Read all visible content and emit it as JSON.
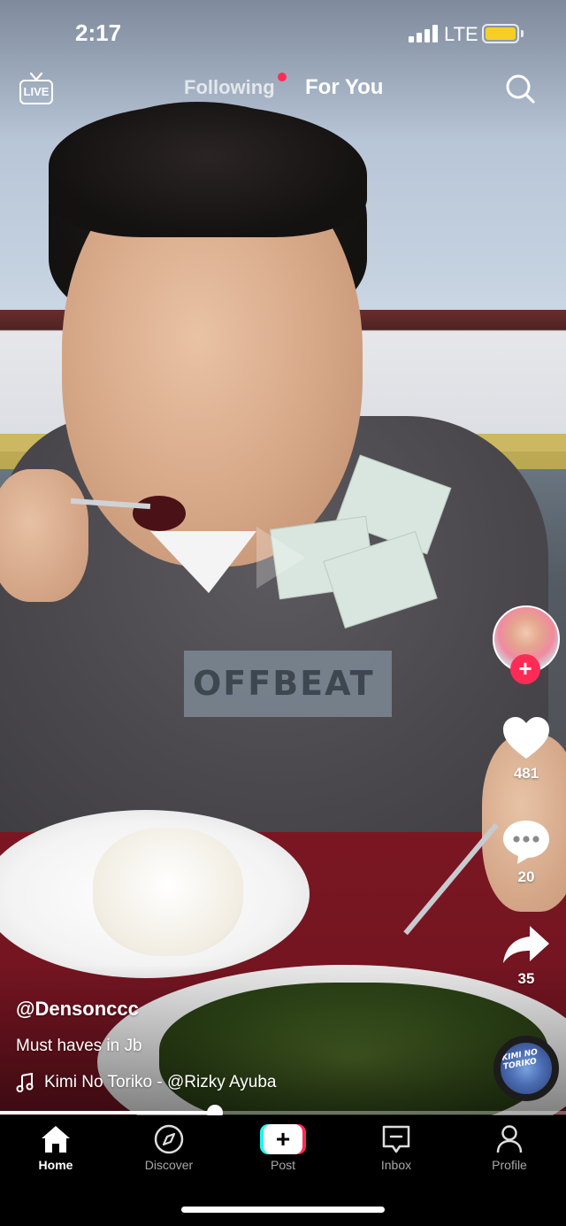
{
  "status_bar": {
    "time": "2:17",
    "network": "LTE",
    "battery_color": "#f5cf24"
  },
  "top_nav": {
    "live_label": "LIVE",
    "tabs": [
      {
        "label": "Following",
        "active": false,
        "has_notification_dot": true
      },
      {
        "label": "For You",
        "active": true
      }
    ],
    "search_icon": "search-icon"
  },
  "video": {
    "username": "@Densonccc",
    "caption": "Must haves in Jb",
    "music": "Kimi No Toriko - @Rizky Ayuba",
    "shirt_print": "OFFBEAT",
    "disc_text": "KIMI NO TORIKO",
    "progress": 0.38
  },
  "actions": {
    "follow_icon": "plus-icon",
    "likes": "481",
    "comments": "20",
    "shares": "35"
  },
  "tabbar": {
    "items": [
      {
        "label": "Home",
        "icon": "home-icon",
        "active": true
      },
      {
        "label": "Discover",
        "icon": "compass-icon",
        "active": false
      },
      {
        "label": "Post",
        "icon": "plus-icon",
        "active": false
      },
      {
        "label": "Inbox",
        "icon": "inbox-icon",
        "active": false
      },
      {
        "label": "Profile",
        "icon": "person-icon",
        "active": false
      }
    ]
  },
  "colors": {
    "accent": "#fe2c55",
    "cyan": "#25f4ee",
    "background": "#000000"
  }
}
